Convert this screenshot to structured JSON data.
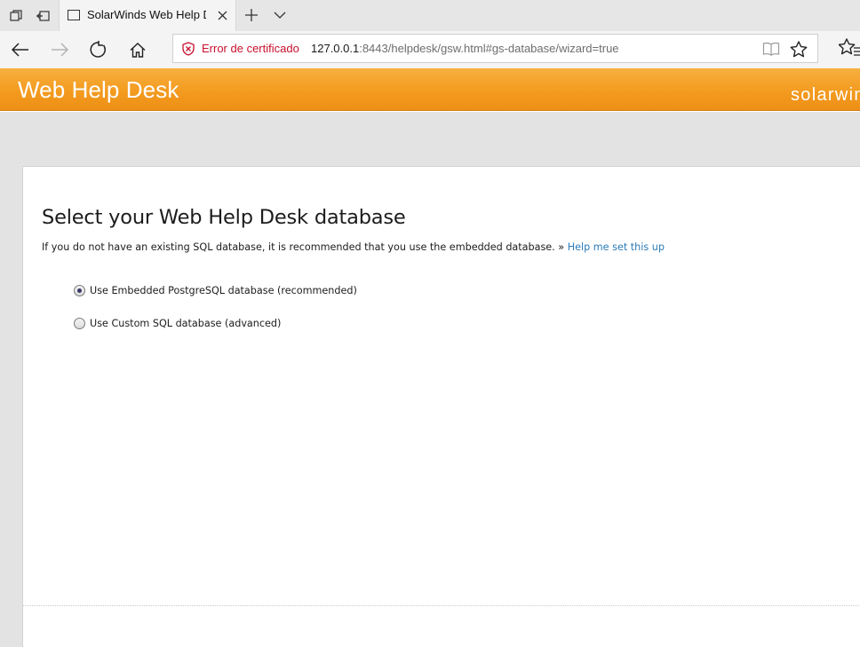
{
  "browser": {
    "tab": {
      "title": "SolarWinds Web Help D"
    },
    "address": {
      "cert_warning": "Error de certificado",
      "url_host": "127.0.0.1",
      "url_rest": ":8443/helpdesk/gsw.html#gs-database/wizard=true"
    },
    "icons": [
      "tab-sets-icon",
      "tabs-aside-icon",
      "page-icon",
      "close-icon",
      "plus-icon",
      "chevron-down-icon",
      "back-arrow-icon",
      "forward-arrow-icon",
      "refresh-icon",
      "home-icon",
      "cert-error-icon",
      "reading-view-icon",
      "favorite-star-icon",
      "hub-icon"
    ]
  },
  "header": {
    "app_title": "Web Help Desk",
    "brand": "solarwinds"
  },
  "main": {
    "title": "Select your Web Help Desk database",
    "description": "If you do not have an existing SQL database, it is recommended that you use the embedded database. »",
    "help_link": "Help me set this up",
    "options": [
      {
        "label": "Use Embedded PostgreSQL database (recommended)",
        "selected": true
      },
      {
        "label": "Use Custom SQL database (advanced)",
        "selected": false
      }
    ]
  },
  "colors": {
    "header_orange": "#f39b1f",
    "link_blue": "#2b7bb9",
    "cert_error_red": "#c8102e",
    "content_gray": "#e3e3e3"
  }
}
